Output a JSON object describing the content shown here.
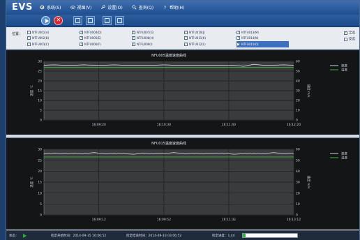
{
  "app": {
    "title": "EVS"
  },
  "menu": [
    {
      "label": "系统(S)",
      "icon": "gear-icon"
    },
    {
      "label": "视图(V)",
      "icon": "eye-icon"
    },
    {
      "label": "设置(O)",
      "icon": "wrench-icon"
    },
    {
      "label": "查询(Q)",
      "icon": "search-icon"
    },
    {
      "label": "帮助(H)",
      "icon": "help-icon"
    }
  ],
  "toolbar": {
    "buttons": [
      "play-icon",
      "stop-icon",
      "device-icon",
      "measure-icon",
      "grid-icon",
      "list-icon"
    ]
  },
  "channels": {
    "label": "位置：",
    "items": [
      {
        "label": "NTFU001(A)",
        "checked": true
      },
      {
        "label": "NTFU004(D)",
        "checked": true
      },
      {
        "label": "NTFU007(G)",
        "checked": true
      },
      {
        "label": "NTFU010(J)",
        "checked": true
      },
      {
        "label": "NTFU013(M)",
        "checked": true
      },
      {
        "label": "NTFU002(B)",
        "checked": true
      },
      {
        "label": "NTFU005(E)",
        "checked": true
      },
      {
        "label": "NTFU008(H)",
        "checked": true
      },
      {
        "label": "NTFU011(K)",
        "checked": true
      },
      {
        "label": "NTFU014(N)",
        "checked": true
      },
      {
        "label": "NTFU003(C)",
        "checked": true
      },
      {
        "label": "NTFU006(F)",
        "checked": true
      },
      {
        "label": "NTFU009(I)",
        "checked": true
      },
      {
        "label": "NTFU012(L)",
        "checked": true
      },
      {
        "label": "NTFU015(O)",
        "checked": true,
        "selected": true
      }
    ],
    "options": [
      {
        "label": "全选",
        "checked": true
      },
      {
        "label": "反选",
        "checked": false
      }
    ]
  },
  "status": {
    "label": "状态：",
    "start_time": "检定开始时间：2014-09-15 16:06:52",
    "end_time": "检定结束时间：2014-09-16 03:06:52",
    "progress_label": "检定进度：1.44",
    "progress": 0.05
  },
  "colors": {
    "speed": "#c9d4e6",
    "temperature": "#38b23a"
  },
  "chart_data": [
    {
      "type": "line",
      "title": "NFU005温度速度曲线",
      "ylabel": "温度 ℃",
      "y2label": "速度 m/s",
      "ylim": [
        0,
        30
      ],
      "y2lim": [
        0,
        60
      ],
      "yticks": [
        0,
        5,
        10,
        15,
        20,
        25,
        30
      ],
      "y2ticks": [
        0,
        10,
        20,
        30,
        40,
        50,
        60
      ],
      "xticks": [
        "16:09:20",
        "16:10:30",
        "16:11:40",
        "16:12:20"
      ],
      "legend": [
        "速度",
        "温度"
      ],
      "legend_position": "top-right",
      "grid": true,
      "x": [
        0,
        4,
        8,
        12,
        16,
        20,
        24,
        28,
        32,
        36,
        40,
        44,
        48,
        52,
        56,
        60,
        64,
        68,
        72,
        76,
        80,
        84,
        88,
        92,
        96,
        100
      ],
      "series": [
        {
          "name": "速度",
          "axis": "right",
          "values": [
            56,
            56.5,
            56,
            56,
            56.5,
            56,
            56,
            56.5,
            56,
            56,
            56,
            56,
            56.5,
            56,
            56,
            56,
            56,
            56,
            56,
            56,
            55,
            57,
            56,
            56,
            56.5,
            56
          ]
        },
        {
          "name": "温度",
          "axis": "left",
          "values": [
            27,
            27,
            27,
            27,
            27,
            27,
            27,
            27,
            27,
            27,
            27,
            27,
            27,
            27,
            27,
            27,
            27,
            27,
            27,
            27,
            27,
            27,
            27,
            27,
            27,
            27
          ]
        }
      ]
    },
    {
      "type": "line",
      "title": "NFU015温度速度曲线",
      "ylabel": "温度 ℃",
      "y2label": "速度 m/s",
      "ylim": [
        0,
        30
      ],
      "y2lim": [
        0,
        60
      ],
      "yticks": [
        0,
        5,
        10,
        15,
        20,
        25,
        30
      ],
      "y2ticks": [
        0,
        10,
        20,
        30,
        40,
        50,
        60
      ],
      "xticks": [
        "16:09:12",
        "16:09:52",
        "16:11:32",
        "16:13:12"
      ],
      "legend": [
        "速度",
        "温度"
      ],
      "legend_position": "top-right",
      "grid": true,
      "x": [
        0,
        4,
        8,
        12,
        16,
        20,
        24,
        28,
        32,
        36,
        40,
        44,
        48,
        52,
        56,
        60,
        64,
        68,
        72,
        76,
        80,
        84,
        88,
        92,
        96,
        100
      ],
      "series": [
        {
          "name": "速度",
          "axis": "right",
          "values": [
            56,
            56.5,
            56,
            56.5,
            56,
            57,
            56,
            56.5,
            56,
            55.5,
            56.5,
            56,
            56,
            57,
            56,
            56.5,
            56,
            56,
            56.5,
            55.5,
            56,
            56.5,
            56,
            57,
            56,
            56.5
          ]
        },
        {
          "name": "温度",
          "axis": "left",
          "values": [
            26.5,
            26.5,
            26.5,
            26.5,
            26.5,
            26.5,
            26.5,
            26.5,
            26.5,
            26.5,
            26.5,
            26.5,
            26.5,
            26.5,
            26.5,
            26.5,
            26.5,
            26.5,
            26.5,
            26.5,
            26.5,
            26.5,
            26.5,
            26.5,
            26.5,
            26.5
          ]
        }
      ]
    }
  ]
}
